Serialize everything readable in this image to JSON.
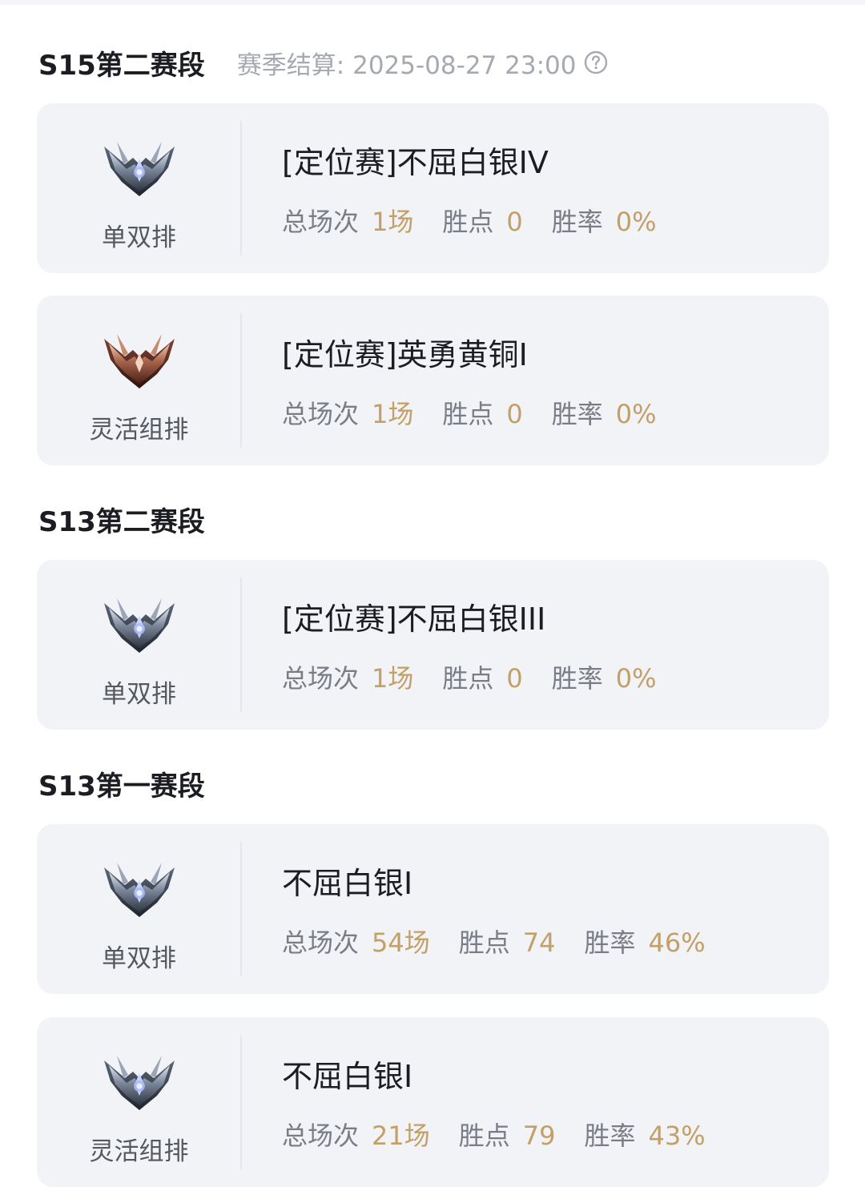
{
  "seasons": [
    {
      "title": "S15第二赛段",
      "settlement": "赛季结算: 2025-08-27 23:00",
      "cards": [
        {
          "queue": "单双排",
          "rank": "[定位赛]不屈白银IV",
          "emblem": "silver-emblem-icon",
          "total_label": "总场次",
          "total": "1场",
          "points_label": "胜点",
          "points": "0",
          "rate_label": "胜率",
          "rate": "0%"
        },
        {
          "queue": "灵活组排",
          "rank": "[定位赛]英勇黄铜I",
          "emblem": "bronze-emblem-icon",
          "total_label": "总场次",
          "total": "1场",
          "points_label": "胜点",
          "points": "0",
          "rate_label": "胜率",
          "rate": "0%"
        }
      ]
    },
    {
      "title": "S13第二赛段",
      "cards": [
        {
          "queue": "单双排",
          "rank": "[定位赛]不屈白银III",
          "emblem": "silver-emblem-icon",
          "total_label": "总场次",
          "total": "1场",
          "points_label": "胜点",
          "points": "0",
          "rate_label": "胜率",
          "rate": "0%"
        }
      ]
    },
    {
      "title": "S13第一赛段",
      "cards": [
        {
          "queue": "单双排",
          "rank": "不屈白银I",
          "emblem": "silver-emblem-icon",
          "total_label": "总场次",
          "total": "54场",
          "points_label": "胜点",
          "points": "74",
          "rate_label": "胜率",
          "rate": "46%"
        },
        {
          "queue": "灵活组排",
          "rank": "不屈白银I",
          "emblem": "silver-emblem-icon",
          "total_label": "总场次",
          "total": "21场",
          "points_label": "胜点",
          "points": "79",
          "rate_label": "胜率",
          "rate": "43%"
        }
      ]
    }
  ],
  "icons": {
    "help": "help-circle-icon"
  },
  "colors": {
    "card_bg": "#f1f3f7",
    "value": "#c2a067",
    "label": "#7a7d85",
    "title": "#1c1d22",
    "muted": "#a6a9b1"
  }
}
